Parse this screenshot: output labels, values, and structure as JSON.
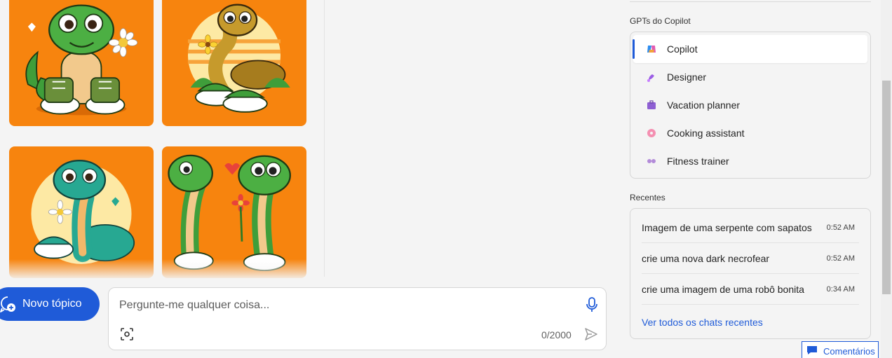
{
  "composer": {
    "new_topic_label": "Novo tópico",
    "placeholder": "Pergunte-me qualquer coisa...",
    "char_count": "0/2000"
  },
  "gpts": {
    "title": "GPTs do Copilot",
    "items": [
      {
        "label": "Copilot",
        "icon": "copilot-icon",
        "active": true
      },
      {
        "label": "Designer",
        "icon": "designer-icon"
      },
      {
        "label": "Vacation planner",
        "icon": "suitcase-icon"
      },
      {
        "label": "Cooking assistant",
        "icon": "donut-icon"
      },
      {
        "label": "Fitness trainer",
        "icon": "dumbbell-icon"
      }
    ]
  },
  "recents": {
    "title": "Recentes",
    "items": [
      {
        "title": "Imagem de uma serpente com sapatos",
        "time": "0:52 AM"
      },
      {
        "title": "crie uma nova dark necrofear",
        "time": "0:52 AM"
      },
      {
        "title": "crie uma imagem de uma robô bonita",
        "time": "0:34 AM"
      }
    ],
    "see_all": "Ver todos os chats recentes"
  },
  "feedback_label": "Comentários",
  "colors": {
    "accent": "#1f5bd8",
    "tile_orange": "#f7840e",
    "snake_green": "#3f9e3a",
    "snake_teal": "#27a892"
  }
}
